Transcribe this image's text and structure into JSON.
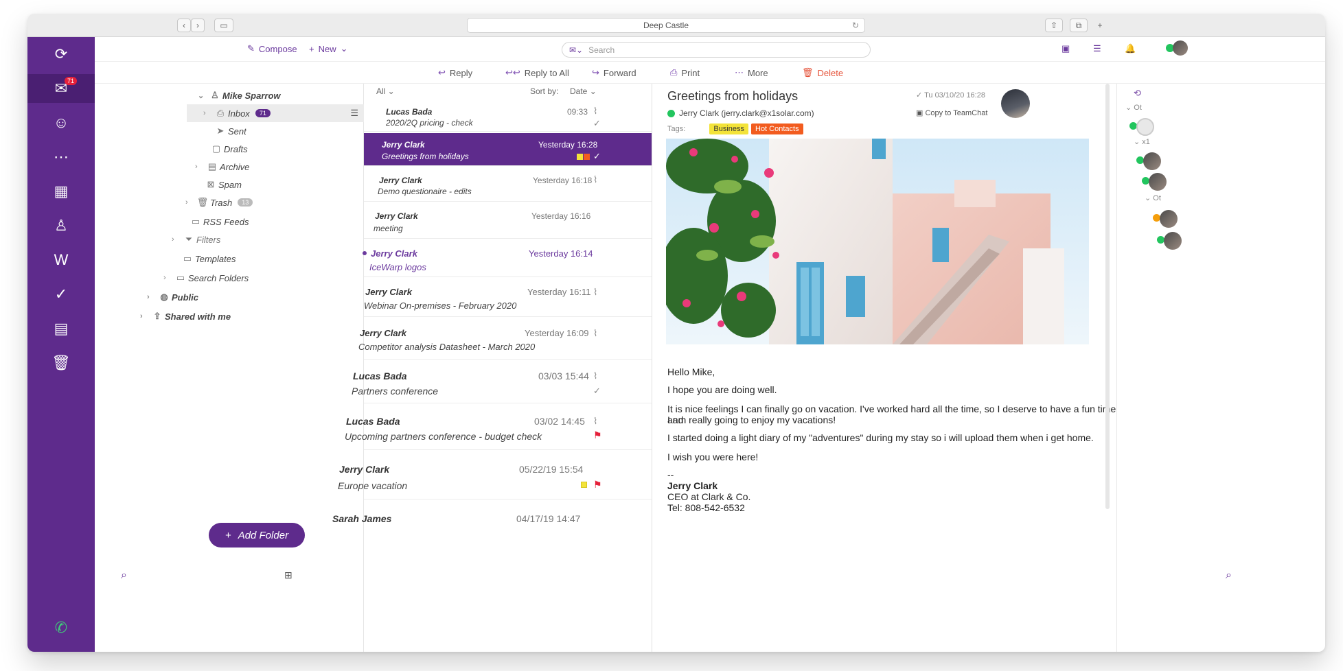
{
  "window": {
    "title": "Deep Castle"
  },
  "toolbar": {
    "compose": "Compose",
    "new": "New",
    "search_placeholder": "Search"
  },
  "actions": {
    "reply": "Reply",
    "reply_all": "Reply to All",
    "forward": "Forward",
    "print": "Print",
    "more": "More",
    "delete": "Delete"
  },
  "rail": {
    "mail_badge": "71"
  },
  "folders": {
    "account": "Mike Sparrow",
    "inbox": "Inbox",
    "inbox_count": "71",
    "sent": "Sent",
    "drafts": "Drafts",
    "archive": "Archive",
    "spam": "Spam",
    "trash": "Trash",
    "trash_count": "13",
    "rss": "RSS Feeds",
    "filters": "Filters",
    "templates": "Templates",
    "search_folders": "Search Folders",
    "public": "Public",
    "shared": "Shared with me",
    "add_folder": "Add Folder"
  },
  "list": {
    "filter": "All",
    "sort_label": "Sort by:",
    "sort_value": "Date",
    "messages": [
      {
        "from": "Lucas Bada",
        "time": "09:33",
        "subject": "2020/2Q pricing - check"
      },
      {
        "from": "Jerry Clark",
        "time": "Yesterday 16:28",
        "subject": "Greetings from holidays"
      },
      {
        "from": "Jerry Clark",
        "time": "Yesterday 16:18",
        "subject": "Demo questionaire - edits"
      },
      {
        "from": "Jerry Clark",
        "time": "Yesterday 16:16",
        "subject": "meeting"
      },
      {
        "from": "Jerry Clark",
        "time": "Yesterday 16:14",
        "subject": "IceWarp logos"
      },
      {
        "from": "Jerry Clark",
        "time": "Yesterday 16:11",
        "subject": "Webinar On-premises - February 2020"
      },
      {
        "from": "Jerry Clark",
        "time": "Yesterday 16:09",
        "subject": "Competitor analysis Datasheet - March 2020"
      },
      {
        "from": "Lucas Bada",
        "time": "03/03 15:44",
        "subject": "Partners conference"
      },
      {
        "from": "Lucas Bada",
        "time": "03/02 14:45",
        "subject": "Upcoming partners conference - budget check"
      },
      {
        "from": "Jerry Clark",
        "time": "05/22/19 15:54",
        "subject": "Europe vacation"
      },
      {
        "from": "Sarah James",
        "time": "04/17/19 14:47",
        "subject": ""
      }
    ]
  },
  "reader": {
    "subject": "Greetings from holidays",
    "sender": "Jerry Clark (jerry.clark@x1solar.com)",
    "date": "Tu 03/10/20 16:28",
    "copy_teamchat": "Copy to TeamChat",
    "tags_label": "Tags:",
    "tag1": "Business",
    "tag2": "Hot Contacts",
    "greeting": "Hello Mike,",
    "p1": "I hope you are doing well.",
    "p2a": "It is nice feelings I can finally go on vacation. I've worked hard all the time, so I deserve to have a fun time and",
    "p2b": "I am really going to enjoy my vacations!",
    "p3": "I started doing a light diary of my \"adventures\" during my stay so i will upload them when i get home.",
    "p4": "I wish you were here!",
    "sig_dash": "--",
    "sig_name": "Jerry Clark",
    "sig_title": "CEO at Clark & Co.",
    "sig_tel": "Tel: 808-542-6532"
  },
  "contacts": {
    "group1": "Ot",
    "group2": "x1",
    "group3": "Ot"
  },
  "colors": {
    "brand": "#5e2b8c",
    "tag_business": "#f3e33a",
    "tag_hot": "#f25c1f",
    "delete": "#e5533a"
  }
}
